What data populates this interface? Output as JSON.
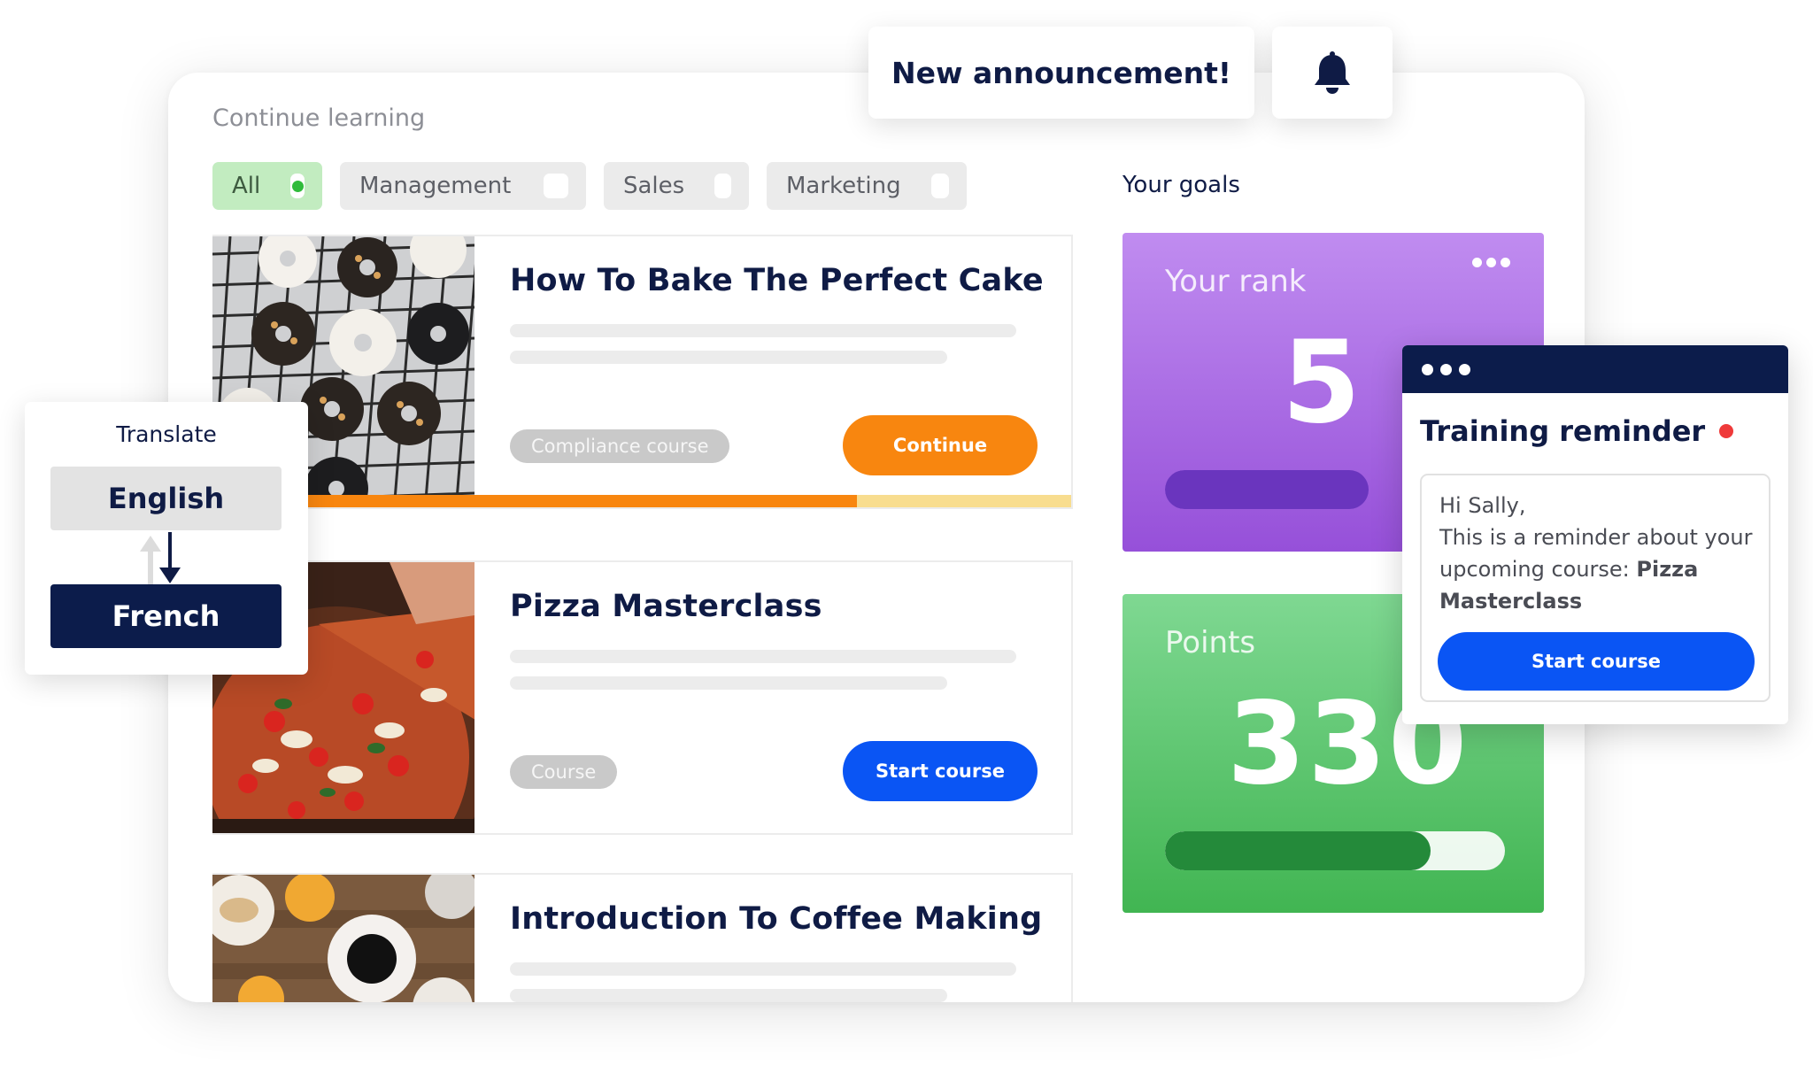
{
  "main": {
    "section_title": "Continue learning",
    "filters": [
      {
        "label": "All",
        "active": true
      },
      {
        "label": "Management",
        "active": false
      },
      {
        "label": "Sales",
        "active": false
      },
      {
        "label": "Marketing",
        "active": false
      }
    ],
    "courses": [
      {
        "title": "How To Bake The Perfect Cake",
        "tag": "Compliance course",
        "button": "Continue",
        "button_color": "#f8860f",
        "progress": 0.75,
        "image": "donuts-on-cooling-rack"
      },
      {
        "title": "Pizza Masterclass",
        "tag": "Course",
        "button": "Start course",
        "button_color": "#0a55f4",
        "image": "pizza-slice"
      },
      {
        "title": "Introduction To Coffee Making",
        "image": "coffee-and-orange-juice"
      }
    ]
  },
  "goals": {
    "title": "Your goals",
    "rank": {
      "label": "Your rank",
      "value": "5",
      "progress": 0.6
    },
    "points": {
      "label": "Points",
      "value": "330",
      "progress": 0.78
    }
  },
  "announcement": {
    "text": "New announcement!",
    "icon": "bell-icon"
  },
  "translate": {
    "label": "Translate",
    "from": "English",
    "to": "French"
  },
  "reminder": {
    "title": "Training reminder",
    "greeting": "Hi Sally,",
    "message": "This is a reminder about your upcoming course:",
    "course_name": "Pizza Masterclass",
    "button": "Start course"
  },
  "colors": {
    "orange": "#f8860f",
    "blue": "#0a55f4",
    "navy": "#0c1c4b",
    "purple": "#9650d9",
    "green": "#41b552",
    "notification_red": "#ef3a3a"
  }
}
